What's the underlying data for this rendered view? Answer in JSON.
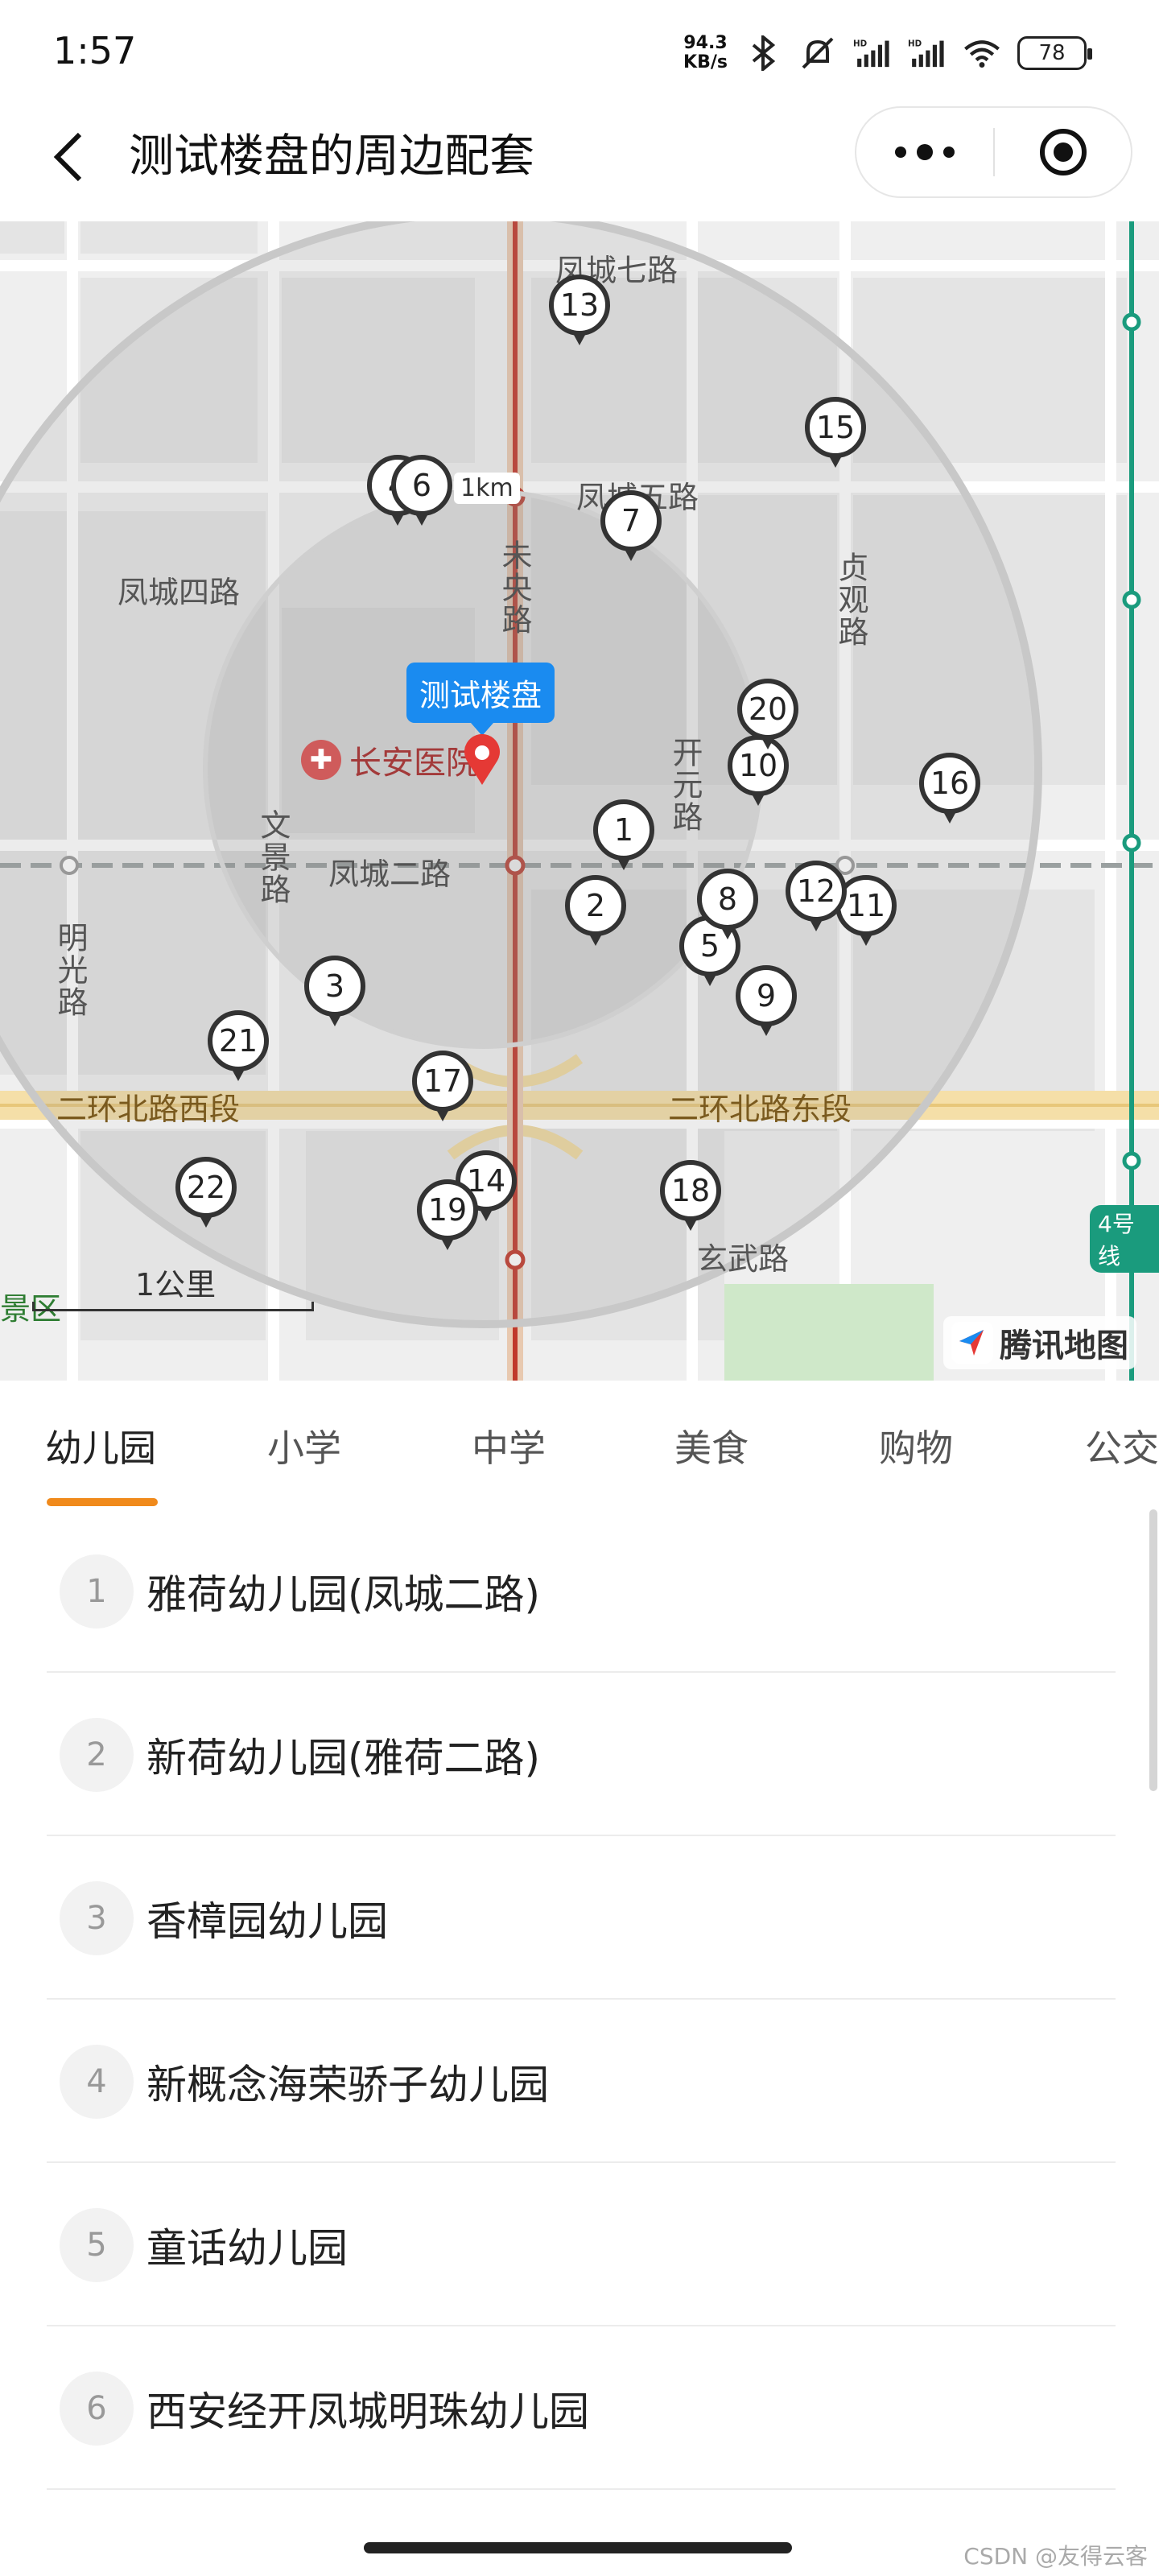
{
  "status_bar": {
    "time": "1:57",
    "net_speed_value": "94.3",
    "net_speed_unit": "KB/s",
    "battery": "78",
    "icons": [
      "bluetooth-icon",
      "mute-icon",
      "signal-hd-icon",
      "signal-hd-icon",
      "wifi-icon",
      "battery-icon"
    ]
  },
  "nav": {
    "title": "测试楼盘的周边配套",
    "back_icon": "back-arrow-icon",
    "more_icon": "more-dots-icon",
    "close_icon": "target-close-icon"
  },
  "map": {
    "radius_label": "1km",
    "center_label": "测试楼盘",
    "hospital_label": "长安医院",
    "scale_label": "1公里",
    "scale_extra": "景区",
    "logo_text": "腾讯地图",
    "metro_badge": "4号线",
    "roads": {
      "fengcheng7": "凤城七路",
      "fengcheng5": "凤城五路",
      "fengcheng4": "凤城四路",
      "fengcheng2": "凤城二路",
      "weiyang": "未央路",
      "zhenguan": "贞观路",
      "kaiyuan": "开元路",
      "wenjing": "文景路",
      "mingguang": "明光路",
      "ring_west": "二环北路西段",
      "ring_east": "二环北路东段",
      "xuanwu": "玄武路"
    },
    "markers": [
      "1",
      "2",
      "3",
      "4",
      "5",
      "6",
      "7",
      "8",
      "9",
      "10",
      "11",
      "12",
      "13",
      "14",
      "15",
      "16",
      "17",
      "18",
      "19",
      "20",
      "21",
      "22"
    ],
    "colors": {
      "accent": "#f08a1c",
      "bubble": "#1a8bf0",
      "pin": "#e53935",
      "metro_red": "#c0392b",
      "metro_green": "#1a9b7d"
    }
  },
  "tabs": [
    {
      "label": "幼儿园",
      "active": true
    },
    {
      "label": "小学",
      "active": false
    },
    {
      "label": "中学",
      "active": false
    },
    {
      "label": "美食",
      "active": false
    },
    {
      "label": "购物",
      "active": false
    },
    {
      "label": "公交",
      "active": false
    }
  ],
  "list": [
    {
      "index": "1",
      "name": "雅荷幼儿园(凤城二路)"
    },
    {
      "index": "2",
      "name": "新荷幼儿园(雅荷二路)"
    },
    {
      "index": "3",
      "name": "香樟园幼儿园"
    },
    {
      "index": "4",
      "name": "新概念海荣骄子幼儿园"
    },
    {
      "index": "5",
      "name": "童话幼儿园"
    },
    {
      "index": "6",
      "name": "西安经开凤城明珠幼儿园"
    }
  ],
  "watermark": "CSDN @友得云客"
}
